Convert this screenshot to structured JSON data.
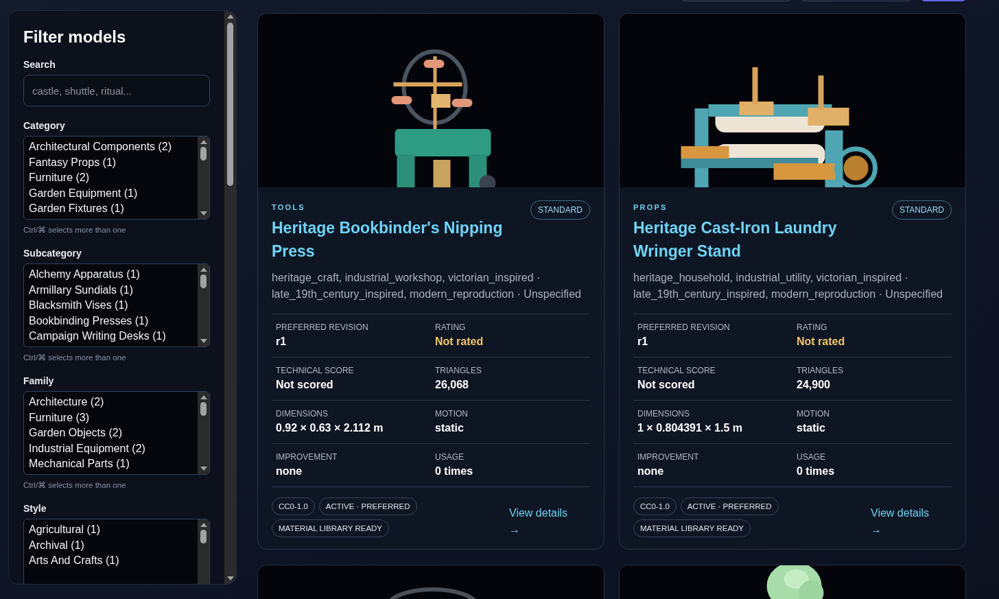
{
  "sidebar": {
    "title": "Filter models",
    "search": {
      "label": "Search",
      "placeholder": "castle, shuttle, ritual..."
    },
    "filters": [
      {
        "label": "Category",
        "hint": "Ctrl/⌘ selects more than one",
        "options": [
          {
            "label": "Architectural Components (2)",
            "selected": false
          },
          {
            "label": "Fantasy Props (1)",
            "selected": false
          },
          {
            "label": "Furniture (2)",
            "selected": false
          },
          {
            "label": "Garden Equipment (1)",
            "selected": false
          },
          {
            "label": "Garden Fixtures (1)",
            "selected": false
          }
        ]
      },
      {
        "label": "Subcategory",
        "hint": "Ctrl/⌘ selects more than one",
        "options": [
          {
            "label": "Alchemy Apparatus (1)",
            "selected": false
          },
          {
            "label": "Armillary Sundials (1)",
            "selected": false
          },
          {
            "label": "Blacksmith Vises (1)",
            "selected": false
          },
          {
            "label": "Bookbinding Presses (1)",
            "selected": false
          },
          {
            "label": "Campaign Writing Desks (1)",
            "selected": false
          }
        ]
      },
      {
        "label": "Family",
        "hint": "Ctrl/⌘ selects more than one",
        "options": [
          {
            "label": "Architecture (2)",
            "selected": false
          },
          {
            "label": "Furniture (3)",
            "selected": false
          },
          {
            "label": "Garden Objects (2)",
            "selected": false
          },
          {
            "label": "Industrial Equipment (2)",
            "selected": false
          },
          {
            "label": "Mechanical Parts (1)",
            "selected": false
          }
        ]
      },
      {
        "label": "Style",
        "options": [
          {
            "label": "Agricultural (1)",
            "selected": false
          },
          {
            "label": "Archival (1)",
            "selected": false
          },
          {
            "label": "Arts And Crafts (1)",
            "selected": false
          }
        ]
      }
    ]
  },
  "cards": [
    {
      "kind": "full",
      "category": "TOOLS",
      "badge": "STANDARD",
      "title": "Heritage Bookbinder's Nipping Press",
      "meta": "heritage_craft, industrial_workshop, victorian_inspired · late_19th_century_inspired, modern_reproduction · Unspecified",
      "stats": [
        {
          "label": "PREFERRED REVISION",
          "value": "r1",
          "highlighted": false
        },
        {
          "label": "RATING",
          "value": "Not rated",
          "highlighted": true
        },
        {
          "label": "TECHNICAL SCORE",
          "value": "Not scored",
          "highlighted": false
        },
        {
          "label": "TRIANGLES",
          "value": "26,068",
          "highlighted": false
        },
        {
          "label": "DIMENSIONS",
          "value": "0.92 × 0.63 × 2.112 m",
          "highlighted": false
        },
        {
          "label": "MOTION",
          "value": "static",
          "highlighted": false
        },
        {
          "label": "IMPROVEMENT",
          "value": "none",
          "highlighted": false
        },
        {
          "label": "USAGE",
          "value": "0 times",
          "highlighted": false
        }
      ],
      "tags": [
        "CC0-1.0",
        "ACTIVE · PREFERRED",
        "MATERIAL LIBRARY READY"
      ],
      "link": "View details →"
    },
    {
      "kind": "full",
      "category": "PROPS",
      "badge": "STANDARD",
      "title": "Heritage Cast-Iron Laundry Wringer Stand",
      "meta": "heritage_household, industrial_utility, victorian_inspired · late_19th_century_inspired, modern_reproduction · Unspecified",
      "stats": [
        {
          "label": "PREFERRED REVISION",
          "value": "r1",
          "highlighted": false
        },
        {
          "label": "RATING",
          "value": "Not rated",
          "highlighted": true
        },
        {
          "label": "TECHNICAL SCORE",
          "value": "Not scored",
          "highlighted": false
        },
        {
          "label": "TRIANGLES",
          "value": "24,900",
          "highlighted": false
        },
        {
          "label": "DIMENSIONS",
          "value": "1 × 0.804391 × 1.5 m",
          "highlighted": false
        },
        {
          "label": "MOTION",
          "value": "static",
          "highlighted": false
        },
        {
          "label": "IMPROVEMENT",
          "value": "none",
          "highlighted": false
        },
        {
          "label": "USAGE",
          "value": "0 times",
          "highlighted": false
        }
      ],
      "tags": [
        "CC0-1.0",
        "ACTIVE · PREFERRED",
        "MATERIAL LIBRARY READY"
      ],
      "link": "View details →"
    },
    {
      "kind": "peek"
    },
    {
      "kind": "peek"
    }
  ]
}
